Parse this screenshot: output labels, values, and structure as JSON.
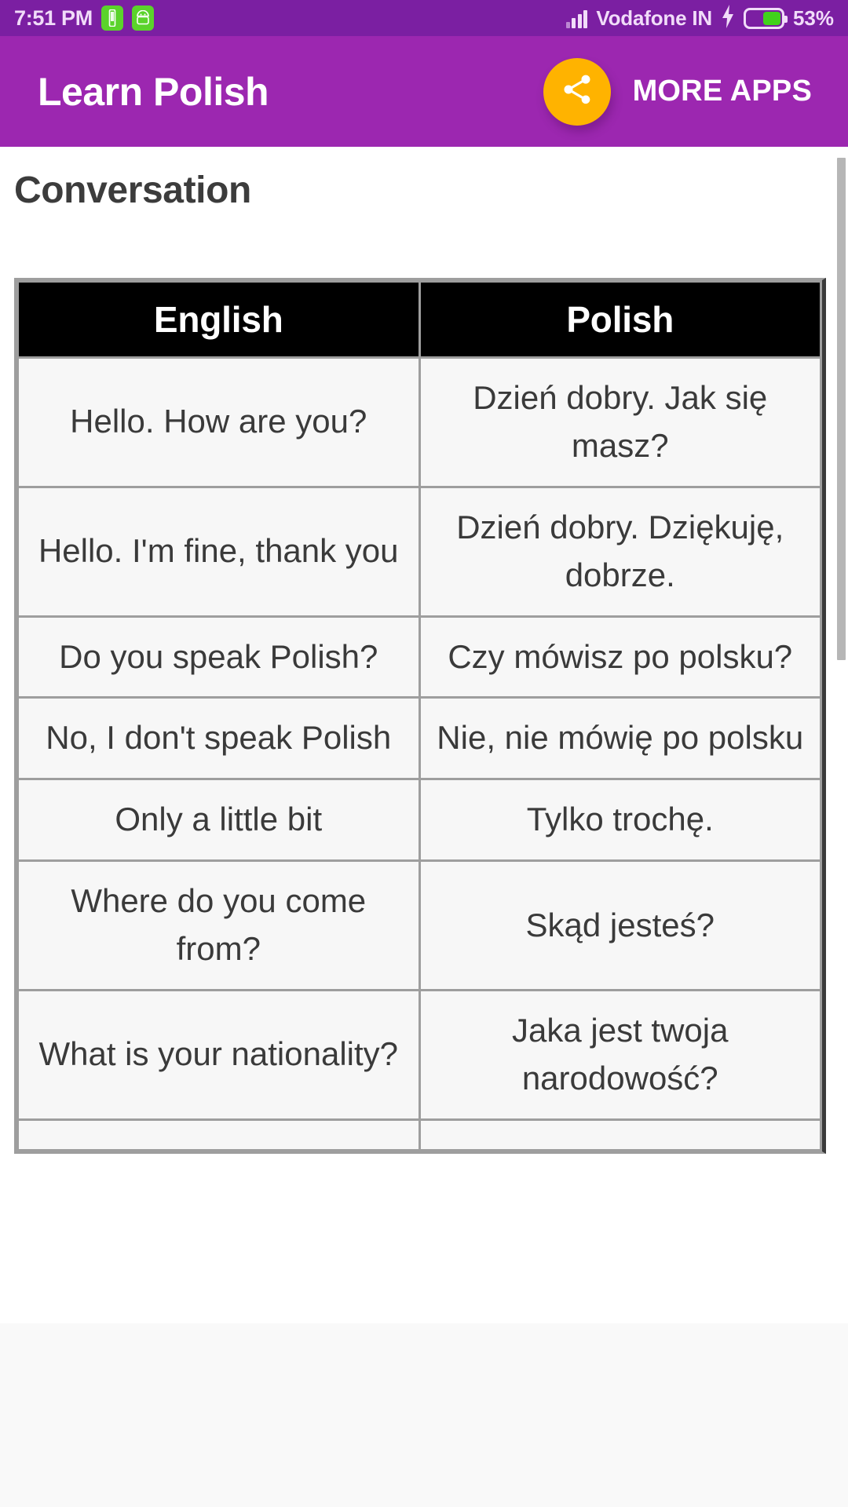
{
  "status_bar": {
    "time": "7:51 PM",
    "carrier": "Vodafone IN",
    "battery_percent": "53%",
    "battery_level": 53,
    "icons": [
      "sim-card-icon",
      "android-robot-icon",
      "signal-bars-icon",
      "charging-bolt-icon",
      "battery-icon"
    ]
  },
  "app_bar": {
    "title": "Learn Polish",
    "share_label": "share-icon",
    "more_apps_label": "MORE APPS",
    "background_color": "#9C27B0",
    "share_button_color": "#FFB300"
  },
  "page": {
    "title": "Conversation"
  },
  "table": {
    "columns": [
      "English",
      "Polish"
    ],
    "rows": [
      {
        "english": "Hello. How are you?",
        "polish": "Dzień dobry. Jak się masz?"
      },
      {
        "english": "Hello. I'm fine, thank you",
        "polish": "Dzień dobry. Dziękuję, dobrze."
      },
      {
        "english": "Do you speak Polish?",
        "polish": "Czy mówisz po polsku?"
      },
      {
        "english": "No, I don't speak Polish",
        "polish": "Nie, nie mówię po polsku"
      },
      {
        "english": "Only a little bit",
        "polish": "Tylko trochę."
      },
      {
        "english": "Where do you come from?",
        "polish": "Skąd jesteś?"
      },
      {
        "english": "What is your nationality?",
        "polish": "Jaka jest twoja narodowość?"
      }
    ]
  },
  "scrollbar": {
    "name": "vertical-scrollbar",
    "color": "#B6B6B6"
  }
}
